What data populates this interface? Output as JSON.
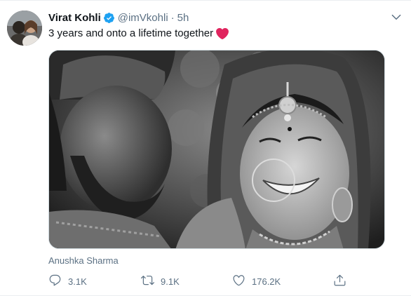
{
  "tweet": {
    "author_name": "Virat Kohli",
    "handle": "@imVkohli",
    "separator": "·",
    "time": "5h",
    "text": "3 years and onto a lifetime together",
    "tagged_person": "Anushka Sharma",
    "icons": {
      "verified": "verified-badge-icon",
      "emoji": "red-heart-emoji-icon",
      "menu": "chevron-down-icon"
    },
    "colors": {
      "verified": "#1da1f2",
      "heart": "#e0245e",
      "secondary_text": "#5b7083"
    }
  },
  "actions": {
    "reply_count": "3.1K",
    "retweet_count": "9.1K",
    "like_count": "176.2K"
  }
}
